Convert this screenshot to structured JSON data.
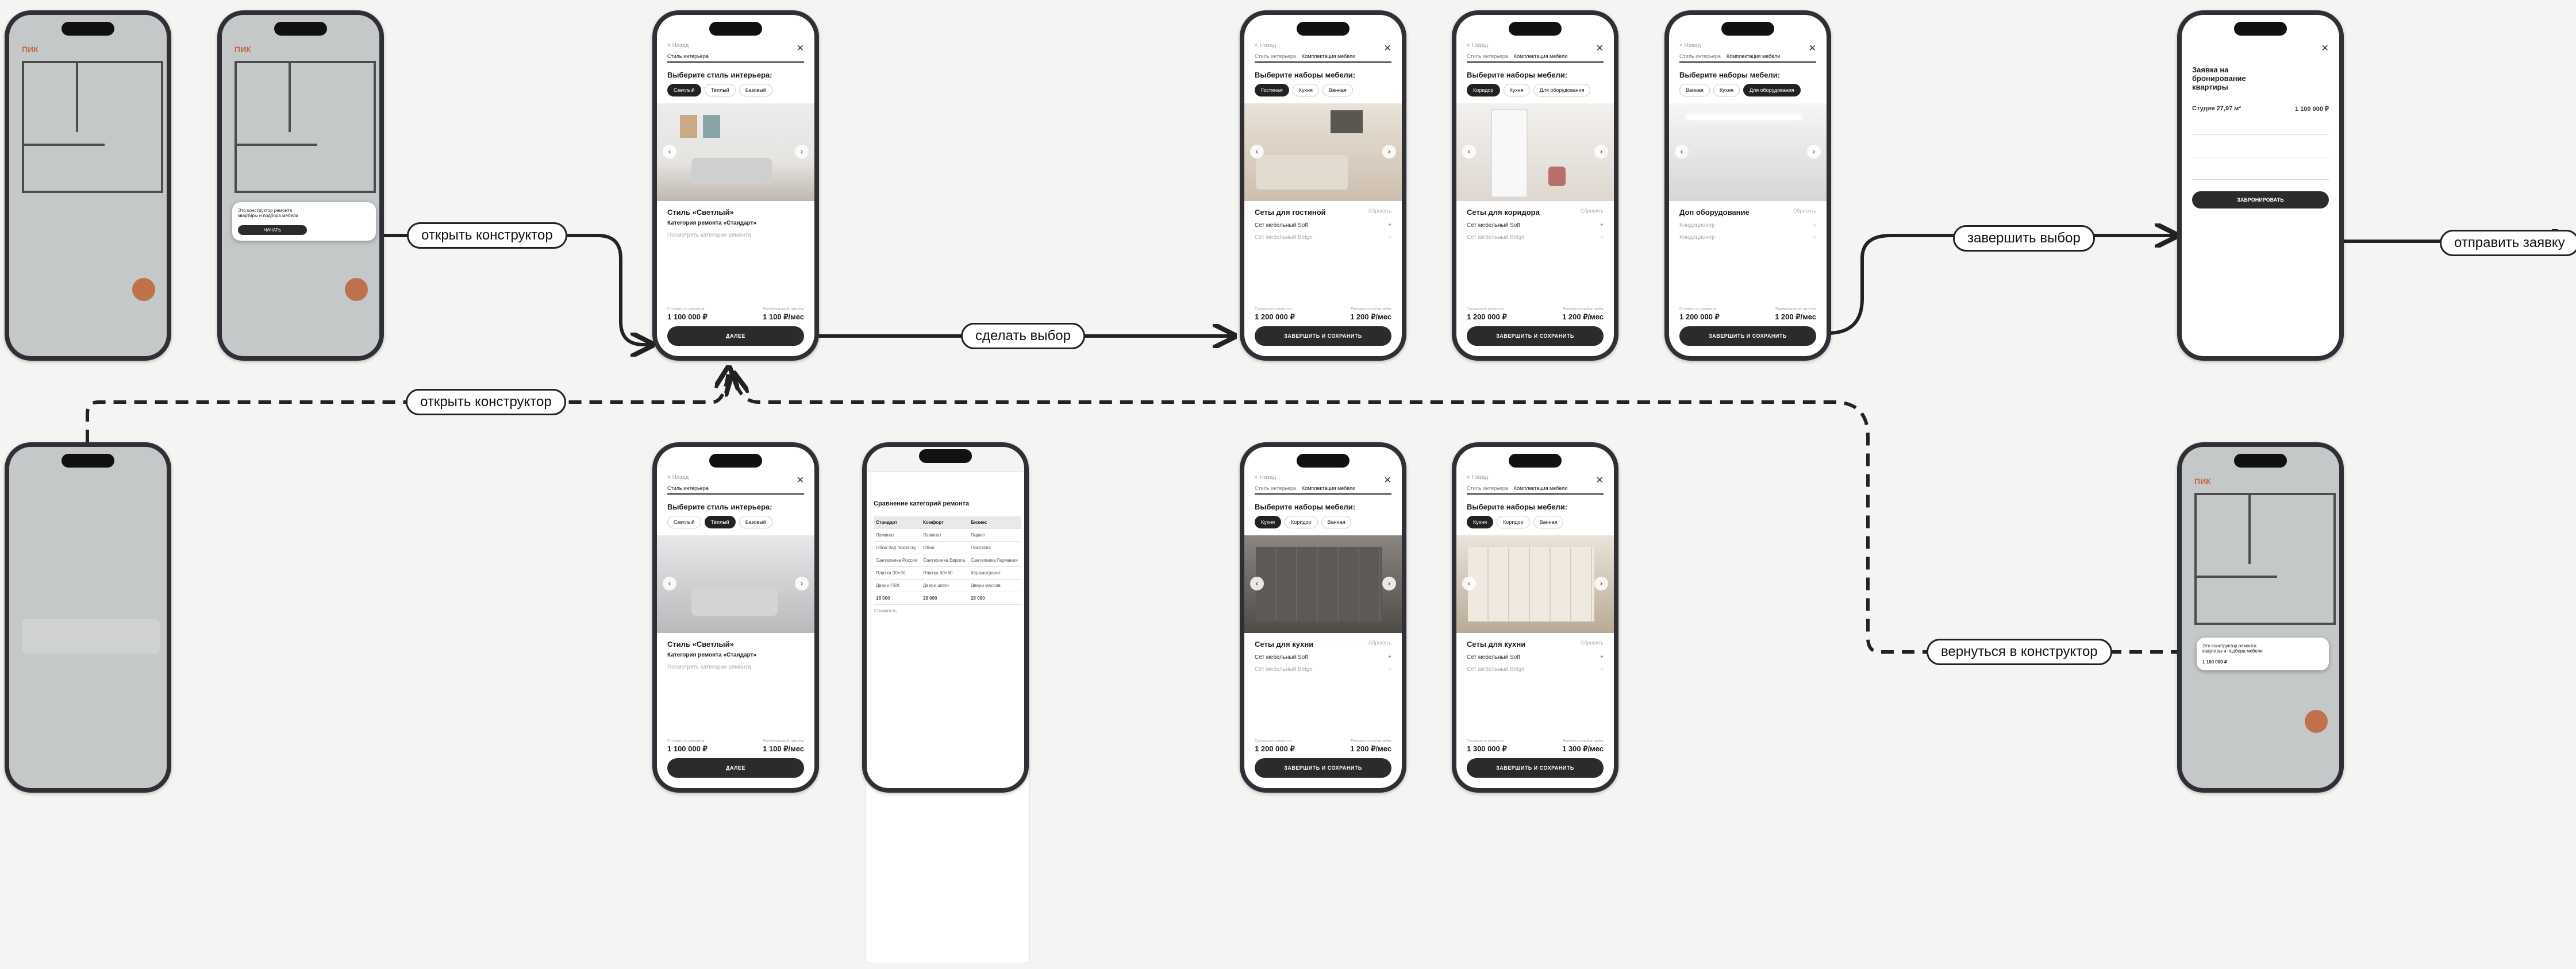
{
  "connectors": {
    "open_constructor_1": "открыть конструктор",
    "make_choice": "сделать выбор",
    "finish_choice": "завершить выбор",
    "send_request": "отправить заявку",
    "open_constructor_2": "открыть конструктор",
    "return_to_constructor": "вернуться в конструктор"
  },
  "common": {
    "back": "< Назад",
    "tab_style": "Стиль интерьера",
    "tab_furniture": "Комплектация мебели",
    "btn_next": "ДАЛЕЕ",
    "btn_finish_save": "ЗАВЕРШИТЬ И СОХРАНИТЬ",
    "price_left": "1 100 000 ₽",
    "price_right": "1 100 ₽/мес",
    "price_left_label": "Стоимость ремонта",
    "price_right_label": "Ежемесячный платёж",
    "logo": "ПИК",
    "remove": "Сбросить"
  },
  "style_screen": {
    "heading": "Выберите стиль интерьера:",
    "chips": [
      "Светлый",
      "Тёплый",
      "Базовый"
    ],
    "title": "Стиль «Светлый»",
    "subtitle": "Категория ремонта «Стандарт»",
    "link": "Посмотреть категории ремонта"
  },
  "style_screen_b": {
    "chips": [
      "Светлый",
      "Тёплый",
      "Базовый"
    ],
    "title": "Стиль «Светлый»",
    "subtitle": "Категория ремонта «Стандарт»",
    "link": "Посмотреть категории ремонта"
  },
  "furniture_heading": "Выберите наборы мебели:",
  "living": {
    "chips": [
      "Гостиная",
      "Кухня",
      "Ванная"
    ],
    "title": "Сеты для гостиной",
    "item1": "Сет мебельный Soft",
    "item2": "Сет мебельный Beige",
    "price_left": "1 200 000 ₽",
    "price_right": "1 200 ₽/мес"
  },
  "hall": {
    "chips": [
      "Коридор",
      "Кухня",
      "Для оборудования"
    ],
    "title": "Сеты для коридора",
    "item1": "Сет мебельный Soft",
    "item2": "Сет мебельный Beige",
    "price_left": "1 200 000 ₽",
    "price_right": "1 200 ₽/мес"
  },
  "equip": {
    "chips": [
      "Ванная",
      "Кухня",
      "Для оборудования"
    ],
    "title": "Доп оборудование",
    "item1": "Кондиционер",
    "item2": "Кондиционер",
    "price_left": "1 200 000 ₽",
    "price_right": "1 200 ₽/мес"
  },
  "kitchen_a": {
    "chips": [
      "Кухня",
      "Коридор",
      "Ванная"
    ],
    "title": "Сеты для кухни",
    "item1": "Сет мебельный Soft",
    "item2": "Сет мебельный Beige",
    "price_left": "1 200 000 ₽",
    "price_right": "1 200 ₽/мес"
  },
  "kitchen_b": {
    "chips": [
      "Кухня",
      "Коридор",
      "Ванная"
    ],
    "title": "Сеты для кухни",
    "item1": "Сет мебельный Soft",
    "item2": "Сет мебельный Beige",
    "price_left": "1 300 000 ₽",
    "price_right": "1 300 ₽/мес"
  },
  "booking": {
    "title": "Заявка на бронирование квартиры",
    "flat": "Студия 27,97 м²",
    "flat_price": "1 100 000 ₽",
    "btn": "ЗАБРОНИРОВАТЬ"
  },
  "compare": {
    "title": "Сравнение категорий ремонта",
    "headers": [
      "Стандарт",
      "Комфорт",
      "Бизнес"
    ],
    "rows": [
      [
        "Ламинат",
        "Ламинат",
        "Паркет"
      ],
      [
        "Обои под покраску",
        "Обои",
        "Покраска"
      ],
      [
        "Сантехника Россия",
        "Сантехника Европа",
        "Сантехника Германия"
      ],
      [
        "Плитка 30×30",
        "Плитка 60×60",
        "Керамогранит"
      ],
      [
        "Двери ПВХ",
        "Двери шпон",
        "Двери массив"
      ]
    ],
    "total_label": "Стоимость",
    "totals": [
      "18 000",
      "28 000",
      "28 000"
    ]
  },
  "plan_screen": {
    "toast": "Это конструктор ремонта квартиры и подбора мебели",
    "toast_btn": "НАЧАТЬ",
    "flat_price": "1 100 000 ₽"
  }
}
